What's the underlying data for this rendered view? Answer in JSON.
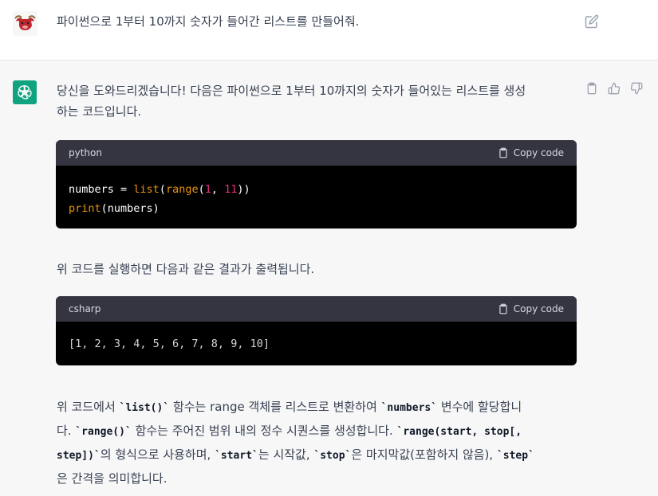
{
  "user_message": {
    "text": "파이썬으로 1부터 10까지 숫자가 들어간 리스트를 만들어줘."
  },
  "assistant": {
    "intro": "당신을 도와드리겠습니다! 다음은 파이썬으로 1부터 10까지의 숫자가 들어있는 리스트를 생성",
    "intro_line2": "하는 코드입니다.",
    "code1": {
      "language": "python",
      "copy_label": "Copy code"
    },
    "between": "위 코드를 실행하면 다음과 같은 결과가 출력됩니다.",
    "code2": {
      "language": "csharp",
      "copy_label": "Copy code",
      "output": "[1, 2, 3, 4, 5, 6, 7, 8, 9, 10]"
    },
    "explain": {
      "l1a": "위 코드에서 ",
      "c1": "`list()`",
      "l1b": " 함수는 range 객체를 리스트로 변환하여 ",
      "c2": "`numbers`",
      "l1c": " 변수에 할당합니",
      "l2a": "다. ",
      "c3": "`range()`",
      "l2b": " 함수는 주어진 범위 내의 정수 시퀀스를 생성합니다. ",
      "c4": "`range(start, stop[,",
      "c5": "step])`",
      "l3a": "의 형식으로 사용하며, ",
      "c6": "`start`",
      "l3b": "는 시작값, ",
      "c7": "`stop`",
      "l3c": "은 마지막값(포함하지 않음), ",
      "c8": "`step`",
      "l4": "은 간격을 의미합니다."
    }
  },
  "colors": {
    "accent": "#10a37f",
    "code_fn": "#e9950c",
    "code_num": "#df3079"
  }
}
